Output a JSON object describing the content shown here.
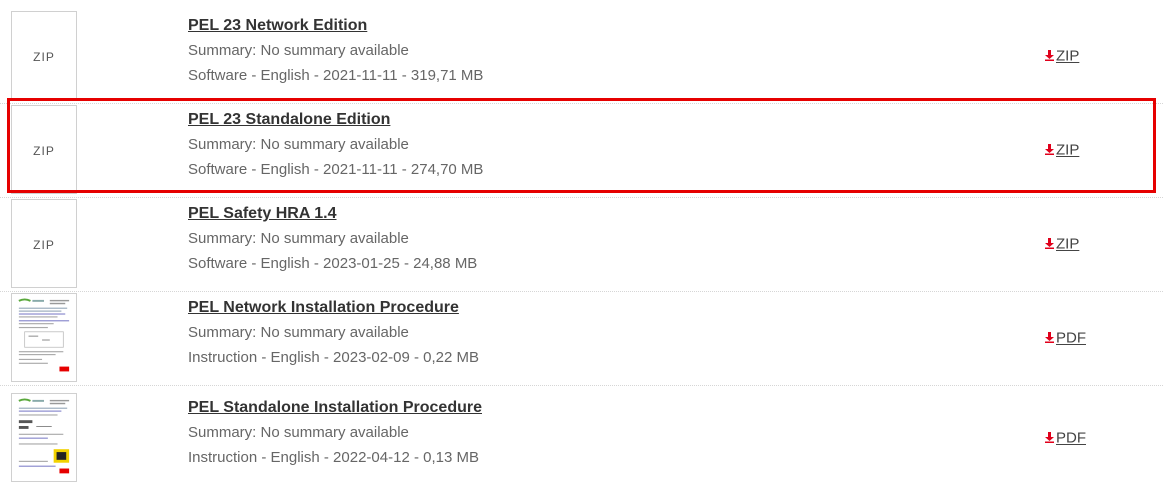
{
  "colors": {
    "accent": "#e60000",
    "download_icon": "#e0001b"
  },
  "items": [
    {
      "thumb": "ZIP",
      "thumb_type": "zip-placeholder",
      "title": "PEL 23 Network Edition",
      "summary": "Summary: No summary available",
      "meta": "Software - English - 2021-11-11 - 319,71 MB",
      "link": "ZIP",
      "icon": "download-icon"
    },
    {
      "thumb": "ZIP",
      "thumb_type": "zip-placeholder",
      "title": "PEL 23 Standalone Edition",
      "summary": "Summary: No summary available",
      "meta": "Software - English - 2021-11-11 - 274,70 MB",
      "link": "ZIP",
      "icon": "download-icon",
      "highlighted": true
    },
    {
      "thumb": "ZIP",
      "thumb_type": "zip-placeholder",
      "title": "PEL Safety HRA 1.4",
      "summary": "Summary: No summary available",
      "meta": "Software - English - 2023-01-25 - 24,88 MB",
      "link": "ZIP",
      "icon": "download-icon"
    },
    {
      "thumb": "",
      "thumb_type": "document-preview",
      "title": "PEL Network Installation Procedure",
      "summary": "Summary: No summary available",
      "meta": "Instruction - English - 2023-02-09 - 0,22 MB",
      "link": "PDF",
      "icon": "download-icon"
    },
    {
      "thumb": "",
      "thumb_type": "document-preview",
      "title": "PEL Standalone Installation Procedure",
      "summary": "Summary: No summary available",
      "meta": "Instruction - English - 2022-04-12 - 0,13 MB",
      "link": "PDF",
      "icon": "download-icon"
    }
  ]
}
